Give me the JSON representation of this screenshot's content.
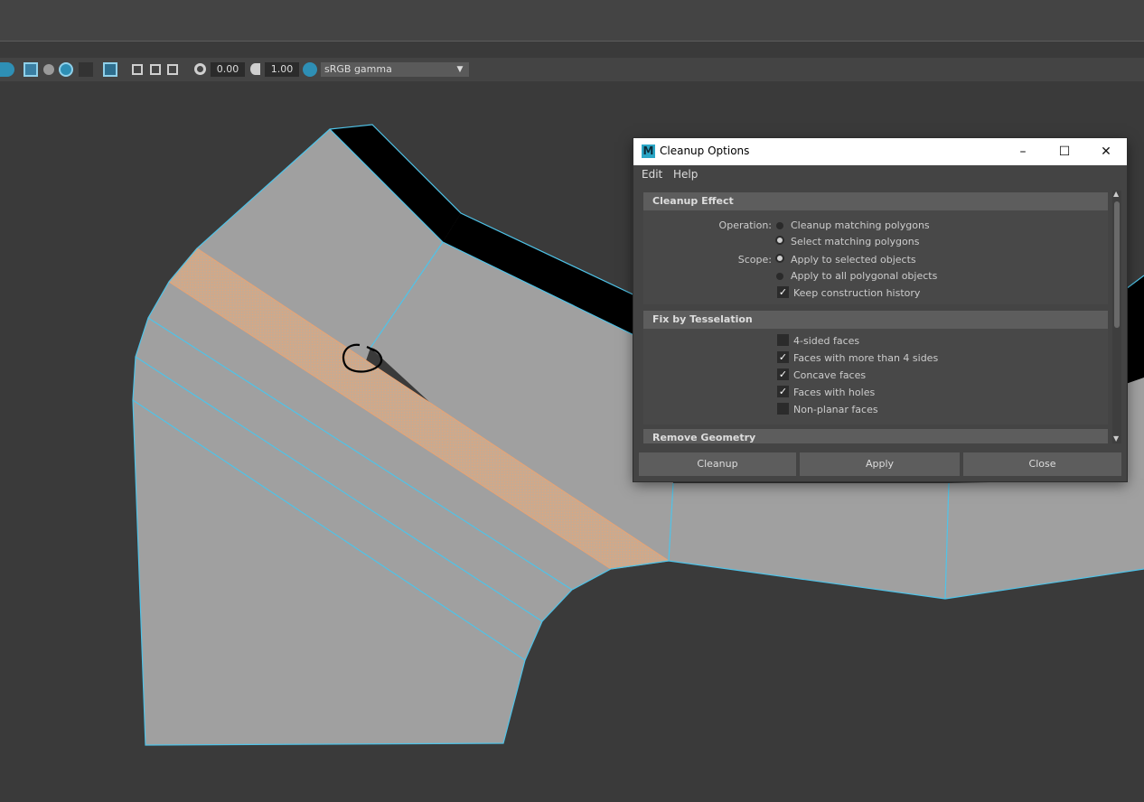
{
  "toolbar": {
    "exposure_value": "0.00",
    "gamma_value": "1.00",
    "color_space": "sRGB gamma",
    "icons": [
      "xray-icon",
      "ambient-occlusion-icon",
      "shadow-icon",
      "antialias-icon",
      "depth-of-field-icon",
      "select-region-icon",
      "isolate-icon",
      "copy-icon",
      "camera-icon",
      "exposure-icon",
      "gamma-icon",
      "color-management-icon",
      "dropdown-arrow-icon"
    ]
  },
  "dialog": {
    "title": "Cleanup Options",
    "app_icon_letter": "M",
    "window_controls": {
      "minimize": "–",
      "maximize": "☐",
      "close": "✕"
    },
    "menu": [
      "Edit",
      "Help"
    ],
    "sections": {
      "cleanup_effect": {
        "header": "Cleanup Effect",
        "operation_label": "Operation:",
        "operation_options": [
          "Cleanup matching polygons",
          "Select matching polygons"
        ],
        "operation_selected": 1,
        "scope_label": "Scope:",
        "scope_options": [
          "Apply to selected objects",
          "Apply to all polygonal objects"
        ],
        "scope_selected": 0,
        "keep_history_label": "Keep construction history",
        "keep_history_checked": true
      },
      "fix_by_tesselation": {
        "header": "Fix by Tesselation",
        "options": [
          {
            "label": "4-sided faces",
            "checked": false
          },
          {
            "label": "Faces with more than 4 sides",
            "checked": true
          },
          {
            "label": "Concave faces",
            "checked": true
          },
          {
            "label": "Faces with holes",
            "checked": true
          },
          {
            "label": "Non-planar faces",
            "checked": false
          }
        ]
      },
      "remove_geometry": {
        "header": "Remove Geometry"
      }
    },
    "buttons": {
      "cleanup": "Cleanup",
      "apply": "Apply",
      "close": "Close"
    },
    "check_glyph": "✓",
    "scroll_up_glyph": "▲",
    "scroll_down_glyph": "▼"
  },
  "colors": {
    "mesh_face": "#a0a0a0",
    "mesh_edge": "#4fc3e8",
    "selected_face": "#e6a476",
    "background": "#3a3a3a",
    "panel": "#444444"
  }
}
